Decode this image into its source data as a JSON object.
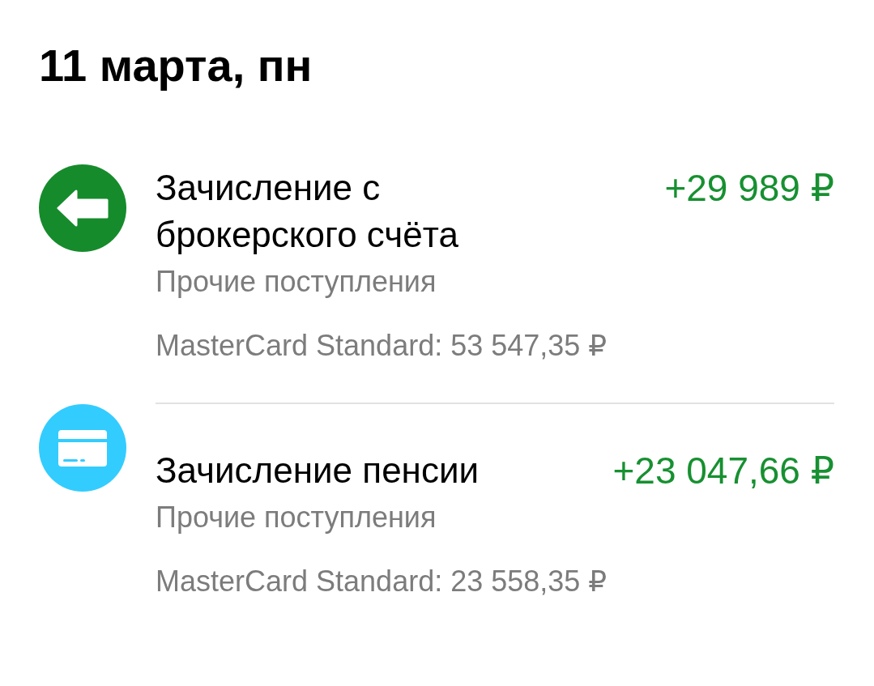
{
  "date_heading": "11 марта, пн",
  "transactions": [
    {
      "icon": {
        "kind": "arrow",
        "color": "#168b2c"
      },
      "title": "Зачисление с брокерского счёта",
      "amount": "+29 989 ₽",
      "category": "Прочие поступления",
      "account": "MasterCard Standard: 53 547,35 ₽"
    },
    {
      "icon": {
        "kind": "card",
        "color": "#33ccff"
      },
      "title": "Зачисление пенсии",
      "amount": "+23 047,66 ₽",
      "category": "Прочие поступления",
      "account": "MasterCard Standard: 23 558,35 ₽"
    }
  ]
}
